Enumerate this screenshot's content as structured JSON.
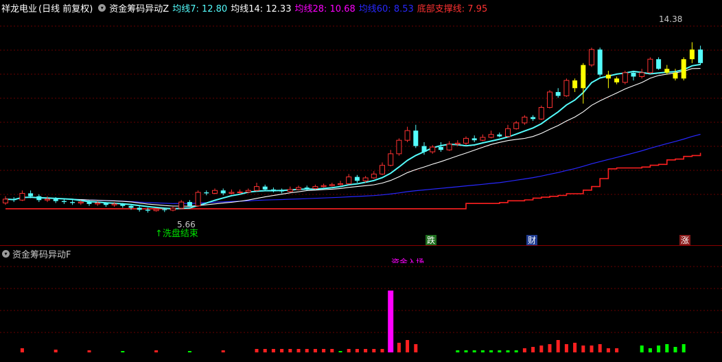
{
  "header": {
    "stock_name": "祥龙电业",
    "period": "(日线 前复权)",
    "indicator_name": "资金筹码异动Z",
    "ma7": "均线7: 12.80",
    "ma14": "均线14: 12.33",
    "ma28": "均线28: 10.68",
    "ma60": "均线60: 8.53",
    "support": "底部支撑线: 7.95"
  },
  "annotations": {
    "high_price": "14.38",
    "low_price": "5.66",
    "wash_end": "↑洗盘结束",
    "sub_top_label": "资金入场"
  },
  "tags": {
    "die": "跌",
    "cai": "财",
    "zhang": "涨"
  },
  "sub_panel": {
    "indicator_name": "资金筹码异动F"
  },
  "colors": {
    "up": "#ff3232",
    "down": "#54fcfc",
    "yellow": "#ffff00",
    "ma7": "#54fcfc",
    "ma14": "#ffffff",
    "ma60": "#2828ff",
    "support": "#ff2020",
    "magenta": "#ff00ff",
    "grid": "#6a0000"
  },
  "chart_data": {
    "type": "candlestick",
    "y_range": [
      5,
      15.5
    ],
    "candles": [
      [
        6.05,
        6.25,
        6.4,
        5.95
      ],
      [
        6.25,
        6.2,
        6.35,
        6.1
      ],
      [
        6.2,
        6.55,
        6.7,
        6.15
      ],
      [
        6.55,
        6.4,
        6.7,
        6.3
      ],
      [
        6.4,
        6.2,
        6.5,
        6.1
      ],
      [
        6.2,
        6.25,
        6.4,
        6.1
      ],
      [
        6.25,
        6.15,
        6.35,
        6.05
      ],
      [
        6.15,
        6.1,
        6.25,
        6.0
      ],
      [
        6.1,
        6.05,
        6.2,
        5.95
      ],
      [
        6.05,
        6.1,
        6.2,
        5.95
      ],
      [
        6.1,
        6.0,
        6.2,
        5.9
      ],
      [
        6.0,
        6.05,
        6.15,
        5.9
      ],
      [
        6.05,
        5.95,
        6.1,
        5.85
      ],
      [
        5.95,
        6.0,
        6.1,
        5.85
      ],
      [
        6.0,
        5.9,
        6.05,
        5.8
      ],
      [
        5.9,
        5.8,
        6.0,
        5.7
      ],
      [
        5.8,
        5.7,
        5.9,
        5.6
      ],
      [
        5.7,
        5.65,
        5.8,
        5.55
      ],
      [
        5.65,
        5.72,
        5.8,
        5.6
      ],
      [
        5.72,
        5.68,
        5.8,
        5.58
      ],
      [
        5.68,
        5.78,
        5.85,
        5.62
      ],
      [
        5.78,
        6.1,
        6.2,
        5.75
      ],
      [
        6.1,
        5.9,
        6.2,
        5.85
      ],
      [
        5.9,
        6.6,
        6.7,
        5.85
      ],
      [
        6.6,
        6.55,
        6.7,
        6.45
      ],
      [
        6.55,
        6.7,
        6.8,
        6.5
      ],
      [
        6.7,
        6.55,
        6.8,
        6.45
      ],
      [
        6.55,
        6.6,
        6.75,
        6.5
      ],
      [
        6.6,
        6.62,
        6.75,
        6.5
      ],
      [
        6.62,
        6.7,
        6.8,
        6.55
      ],
      [
        6.7,
        6.9,
        7.1,
        6.65
      ],
      [
        6.9,
        6.75,
        7.0,
        6.7
      ],
      [
        6.75,
        6.7,
        6.85,
        6.6
      ],
      [
        6.7,
        6.65,
        6.8,
        6.55
      ],
      [
        6.65,
        6.75,
        6.9,
        6.6
      ],
      [
        6.75,
        6.85,
        6.95,
        6.7
      ],
      [
        6.85,
        6.8,
        6.95,
        6.7
      ],
      [
        6.8,
        6.9,
        7.0,
        6.75
      ],
      [
        6.9,
        6.95,
        7.05,
        6.85
      ],
      [
        6.95,
        7.0,
        7.1,
        6.9
      ],
      [
        7.0,
        7.05,
        7.2,
        6.95
      ],
      [
        7.05,
        7.4,
        7.55,
        7.0
      ],
      [
        7.4,
        7.2,
        7.5,
        7.1
      ],
      [
        7.2,
        7.35,
        7.45,
        7.1
      ],
      [
        7.35,
        7.55,
        7.7,
        7.3
      ],
      [
        7.55,
        8.0,
        8.15,
        7.5
      ],
      [
        8.0,
        8.6,
        8.8,
        7.95
      ],
      [
        8.6,
        9.3,
        9.4,
        8.5
      ],
      [
        9.3,
        9.8,
        10.0,
        9.2
      ],
      [
        9.8,
        9.0,
        10.1,
        8.9
      ],
      [
        9.0,
        8.7,
        9.2,
        8.55
      ],
      [
        8.7,
        8.95,
        9.05,
        8.6
      ],
      [
        8.95,
        8.8,
        9.2,
        8.7
      ],
      [
        8.8,
        9.1,
        9.25,
        8.75
      ],
      [
        9.1,
        9.15,
        9.3,
        9.0
      ],
      [
        9.15,
        9.4,
        9.5,
        9.05
      ],
      [
        9.4,
        9.3,
        9.55,
        9.2
      ],
      [
        9.3,
        9.45,
        9.6,
        9.25
      ],
      [
        9.45,
        9.6,
        9.8,
        9.4
      ],
      [
        9.6,
        9.5,
        9.7,
        9.45
      ],
      [
        9.5,
        9.9,
        10.1,
        9.45
      ],
      [
        9.9,
        10.2,
        10.3,
        9.85
      ],
      [
        10.2,
        10.5,
        10.6,
        10.1
      ],
      [
        10.5,
        10.4,
        10.6,
        10.3
      ],
      [
        10.4,
        11.0,
        11.1,
        10.35
      ],
      [
        11.0,
        11.8,
        11.9,
        10.95
      ],
      [
        11.8,
        11.6,
        12.0,
        11.5
      ],
      [
        11.6,
        12.4,
        12.5,
        11.55
      ],
      [
        12.4,
        12.0,
        12.5,
        11.8
      ],
      [
        12.0,
        13.2,
        13.3,
        11.2
      ],
      [
        13.2,
        14.0,
        14.1,
        13.1
      ],
      [
        14.0,
        12.7,
        14.1,
        12.6
      ],
      [
        12.7,
        12.5,
        12.9,
        12.0
      ],
      [
        12.5,
        12.3,
        12.6,
        12.2
      ],
      [
        12.3,
        12.8,
        12.9,
        12.2
      ],
      [
        12.8,
        12.6,
        12.9,
        12.4
      ],
      [
        12.6,
        12.8,
        13.0,
        12.5
      ],
      [
        12.8,
        13.5,
        13.6,
        12.75
      ],
      [
        13.5,
        13.0,
        13.6,
        12.95
      ],
      [
        13.0,
        12.8,
        13.2,
        12.7
      ],
      [
        12.8,
        12.5,
        13.0,
        12.4
      ],
      [
        12.5,
        13.5,
        13.6,
        12.4
      ],
      [
        13.5,
        14.0,
        14.38,
        13.3
      ],
      [
        14.0,
        13.3,
        14.2,
        13.2
      ]
    ],
    "yellow_idx": [
      68,
      69,
      72,
      73,
      79,
      80,
      81,
      82
    ],
    "sub_bars": [
      [
        2,
        "r",
        6
      ],
      [
        6,
        "r",
        4
      ],
      [
        10,
        "r",
        3
      ],
      [
        14,
        "g",
        2
      ],
      [
        18,
        "r",
        3
      ],
      [
        22,
        "g",
        2
      ],
      [
        26,
        "r",
        3
      ],
      [
        30,
        "r",
        5
      ],
      [
        31,
        "r",
        5
      ],
      [
        32,
        "r",
        5
      ],
      [
        33,
        "r",
        5
      ],
      [
        34,
        "r",
        5
      ],
      [
        35,
        "r",
        5
      ],
      [
        36,
        "r",
        5
      ],
      [
        37,
        "r",
        5
      ],
      [
        38,
        "r",
        5
      ],
      [
        39,
        "r",
        5
      ],
      [
        40,
        "g",
        2
      ],
      [
        41,
        "r",
        5
      ],
      [
        42,
        "r",
        5
      ],
      [
        43,
        "r",
        5
      ],
      [
        44,
        "r",
        5
      ],
      [
        45,
        "r",
        5
      ],
      [
        46,
        "m",
        90
      ],
      [
        47,
        "r",
        14
      ],
      [
        48,
        "r",
        18
      ],
      [
        49,
        "r",
        12
      ],
      [
        54,
        "g",
        3
      ],
      [
        55,
        "g",
        3
      ],
      [
        56,
        "g",
        3
      ],
      [
        57,
        "g",
        3
      ],
      [
        58,
        "g",
        3
      ],
      [
        59,
        "g",
        3
      ],
      [
        60,
        "g",
        3
      ],
      [
        61,
        "g",
        3
      ],
      [
        62,
        "r",
        6
      ],
      [
        63,
        "r",
        8
      ],
      [
        64,
        "r",
        10
      ],
      [
        65,
        "r",
        12
      ],
      [
        66,
        "r",
        18
      ],
      [
        67,
        "r",
        12
      ],
      [
        68,
        "r",
        14
      ],
      [
        69,
        "r",
        10
      ],
      [
        70,
        "r",
        10
      ],
      [
        71,
        "r",
        12
      ],
      [
        72,
        "r",
        6
      ],
      [
        73,
        "r",
        6
      ],
      [
        76,
        "g",
        10
      ],
      [
        77,
        "g",
        6
      ],
      [
        78,
        "g",
        10
      ],
      [
        79,
        "g",
        12
      ],
      [
        80,
        "g",
        8
      ],
      [
        81,
        "g",
        12
      ]
    ]
  }
}
